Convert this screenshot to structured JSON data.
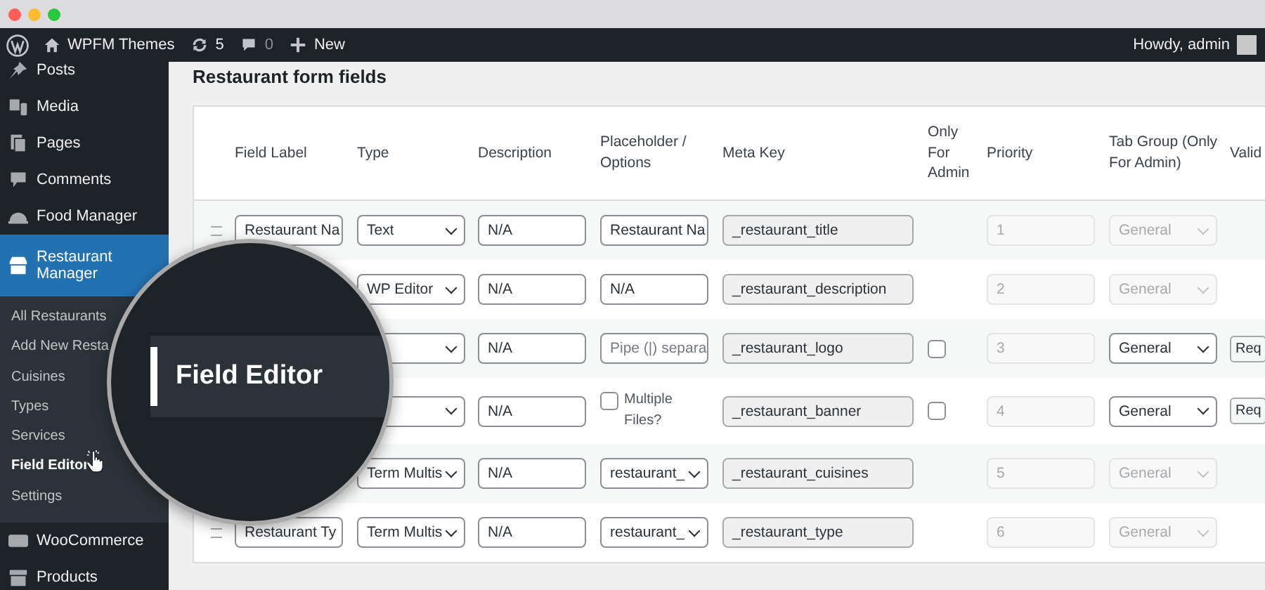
{
  "admin_bar": {
    "site_name": "WPFM Themes",
    "updates": "5",
    "comments": "0",
    "new_label": "New",
    "greeting": "Howdy, admin"
  },
  "sidebar": {
    "items": [
      {
        "label": "Posts",
        "kind": "pin",
        "selected": false
      },
      {
        "label": "Media",
        "kind": "media",
        "selected": false
      },
      {
        "label": "Pages",
        "kind": "pages",
        "selected": false
      },
      {
        "label": "Comments",
        "kind": "comment",
        "selected": false
      },
      {
        "label": "Food Manager",
        "kind": "food",
        "selected": false
      },
      {
        "label": "Restaurant Manager",
        "kind": "store",
        "selected": true,
        "expanded": true,
        "children": [
          {
            "label": "All Restaurants",
            "selected": false
          },
          {
            "label": "Add New Resta",
            "selected": false
          },
          {
            "label": "Cuisines",
            "selected": false
          },
          {
            "label": "Types",
            "selected": false
          },
          {
            "label": "Services",
            "selected": false
          },
          {
            "label": "Field Editor",
            "selected": true
          },
          {
            "label": "Settings",
            "selected": false
          }
        ]
      },
      {
        "label": "WooCommerce",
        "kind": "woo",
        "selected": false
      },
      {
        "label": "Products",
        "kind": "box",
        "selected": false
      }
    ]
  },
  "magnifier": {
    "label": "Field Editor"
  },
  "page_title": "Restaurant form fields",
  "table": {
    "columns": [
      "Field Label",
      "Type",
      "Description",
      "Placeholder / Options",
      "Meta Key",
      "Only For Admin",
      "Priority",
      "Tab Group (Only For Admin)",
      "Valid"
    ],
    "rows": [
      {
        "label": "Restaurant Na",
        "type": "Text",
        "description": "N/A",
        "placeholder": {
          "kind": "input",
          "text": "Restaurant Na"
        },
        "meta_key": "_restaurant_title",
        "priority": "1",
        "tab_group": "General",
        "disabled": true
      },
      {
        "type": "WP Editor",
        "description": "N/A",
        "placeholder": {
          "kind": "input",
          "text": "N/A"
        },
        "meta_key": "_restaurant_description",
        "priority": "2",
        "tab_group": "General",
        "disabled": true
      },
      {
        "description": "N/A",
        "placeholder": {
          "kind": "hint",
          "text": "Pipe (|) separa"
        },
        "meta_key": "_restaurant_logo",
        "admin_only": false,
        "priority": "3",
        "tab_group": "General",
        "disabled": false,
        "validation": "Req"
      },
      {
        "description": "N/A",
        "placeholder": {
          "kind": "checkbox",
          "text": "Multiple Files?",
          "checked": false
        },
        "meta_key": "_restaurant_banner",
        "admin_only": false,
        "priority": "4",
        "tab_group": "General",
        "disabled": false,
        "validation": "Req"
      },
      {
        "type": "Term Multis",
        "description": "N/A",
        "placeholder": {
          "kind": "select",
          "text": "restaurant_"
        },
        "meta_key": "_restaurant_cuisines",
        "priority": "5",
        "tab_group": "General",
        "disabled": true
      },
      {
        "label": "Restaurant Ty",
        "type": "Term Multis",
        "description": "N/A",
        "placeholder": {
          "kind": "select",
          "text": "restaurant_"
        },
        "meta_key": "_restaurant_type",
        "priority": "6",
        "tab_group": "General",
        "disabled": true
      }
    ]
  }
}
